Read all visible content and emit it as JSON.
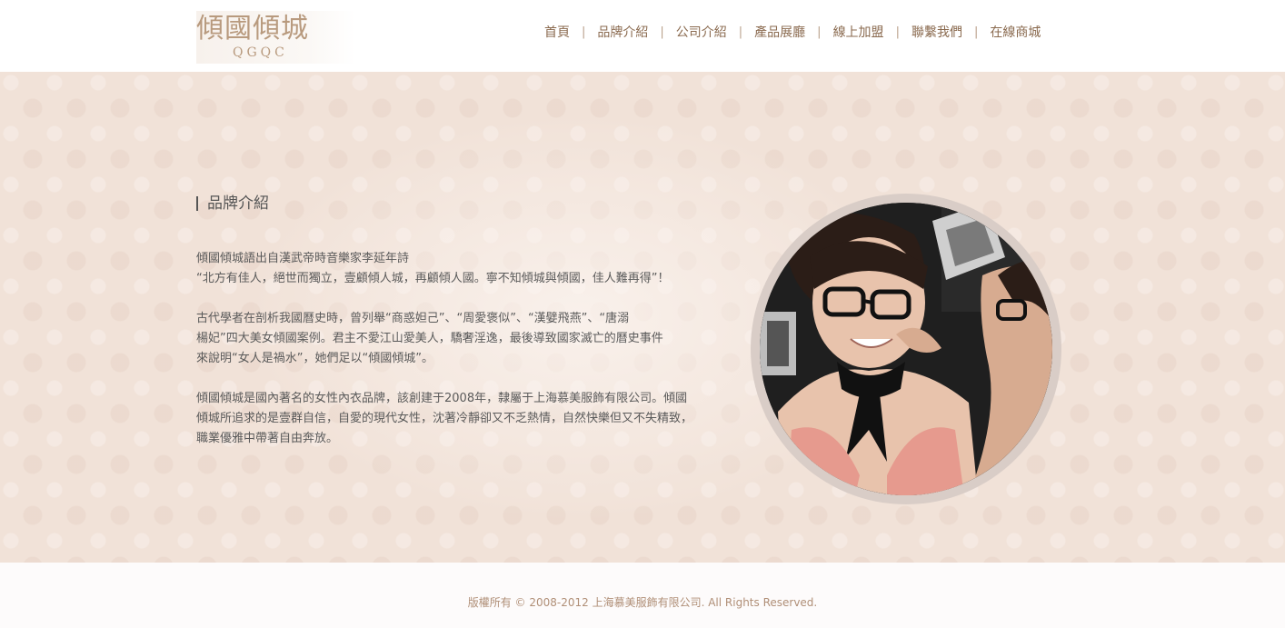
{
  "header": {
    "logo_text": "傾國傾城",
    "logo_sub": "QGQC",
    "nav": [
      {
        "label": "首頁"
      },
      {
        "label": "品牌介紹"
      },
      {
        "label": "公司介紹"
      },
      {
        "label": "產品展廳"
      },
      {
        "label": "線上加盟"
      },
      {
        "label": "聯繫我們"
      },
      {
        "label": "在線商城"
      }
    ],
    "nav_separator": "|"
  },
  "main": {
    "section_title": "品牌介紹",
    "paragraphs": [
      [
        "傾國傾城語出自漢武帝時音樂家李延年詩",
        "“北方有佳人，絕世而獨立，壹顧傾人城，再顧傾人國。寧不知傾城與傾國，佳人難再得”！"
      ],
      [
        "古代學者在剖析我國曆史時，曾列舉“商惑妲己”、“周愛褒似”、“漢嬖飛燕”、“唐溺",
        "楊妃”四大美女傾國案例。君主不愛江山愛美人，驕奢淫逸，最後導致國家滅亡的曆史事件",
        "來說明“女人是禍水”，她們足以“傾國傾城”。"
      ],
      [
        "傾國傾城是國內著名的女性內衣品牌，該創建于2008年，隸屬于上海慕美服飾有限公司。傾國",
        "傾城所追求的是壹群自信，自愛的現代女性，沈著冷靜卻又不乏熱情，自然快樂但又不失精致，",
        "職業優雅中帶著自由奔放。"
      ]
    ]
  },
  "footer": {
    "copyright": "版權所有 © 2008-2012 上海慕美服飾有限公司. All Rights Reserved."
  },
  "colors": {
    "accent": "#8a6a4f",
    "background": "#f1e2d8"
  }
}
